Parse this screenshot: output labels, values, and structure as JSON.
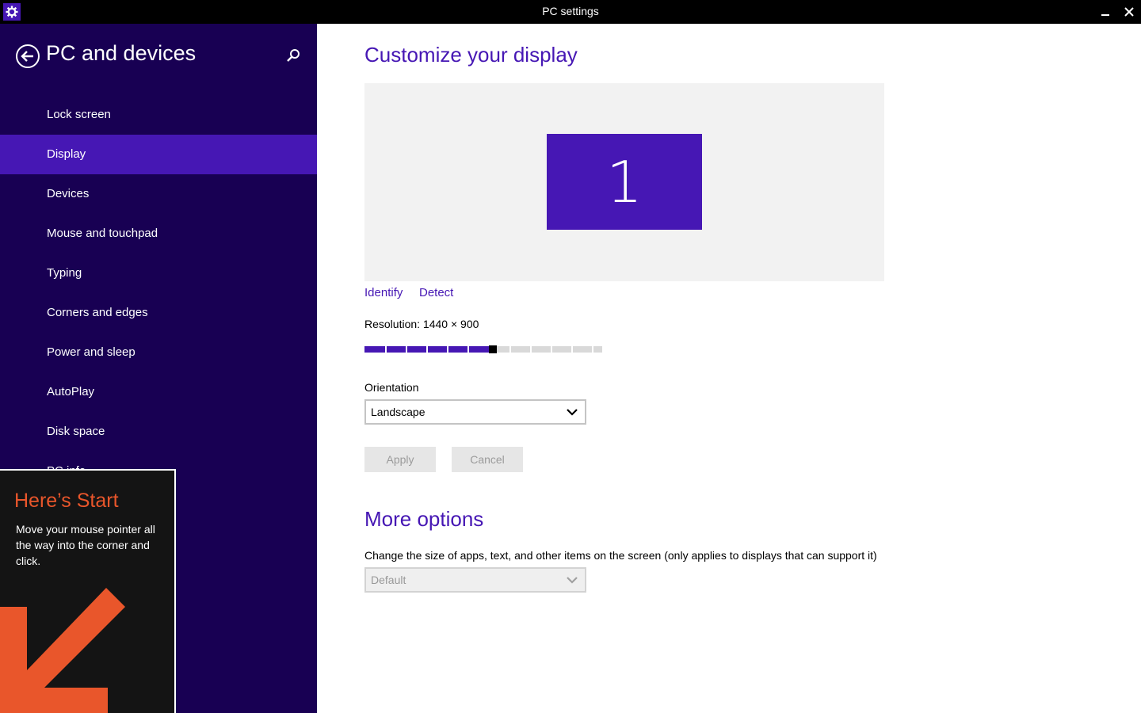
{
  "titlebar": {
    "title": "PC settings",
    "app_icon": "gear-icon",
    "minimize_icon": "minimize-icon",
    "close_icon": "close-icon"
  },
  "sidebar": {
    "title": "PC and devices",
    "back_icon": "back-arrow-icon",
    "search_icon": "search-icon",
    "items": [
      {
        "label": "Lock screen",
        "selected": false
      },
      {
        "label": "Display",
        "selected": true
      },
      {
        "label": "Devices",
        "selected": false
      },
      {
        "label": "Mouse and touchpad",
        "selected": false
      },
      {
        "label": "Typing",
        "selected": false
      },
      {
        "label": "Corners and edges",
        "selected": false
      },
      {
        "label": "Power and sleep",
        "selected": false
      },
      {
        "label": "AutoPlay",
        "selected": false
      },
      {
        "label": "Disk space",
        "selected": false
      },
      {
        "label": "PC info",
        "selected": false
      }
    ]
  },
  "start_tip": {
    "title": "Here’s Start",
    "text": "Move your mouse pointer all the way into the corner and click."
  },
  "main": {
    "heading": "Customize your display",
    "monitor_number": "1",
    "identify_label": "Identify",
    "detect_label": "Detect",
    "resolution_text": "Resolution: 1440 × 900",
    "resolution_slider": {
      "position": 6,
      "steps": 12
    },
    "orientation_label": "Orientation",
    "orientation_value": "Landscape",
    "apply_label": "Apply",
    "cancel_label": "Cancel",
    "more_options_heading": "More options",
    "size_description": "Change the size of apps, text, and other items on the screen (only applies to displays that can support it)",
    "size_value": "Default"
  },
  "colors": {
    "accent": "#4617b4",
    "sidebar_bg": "#180053",
    "tip_title": "#e9562b"
  }
}
